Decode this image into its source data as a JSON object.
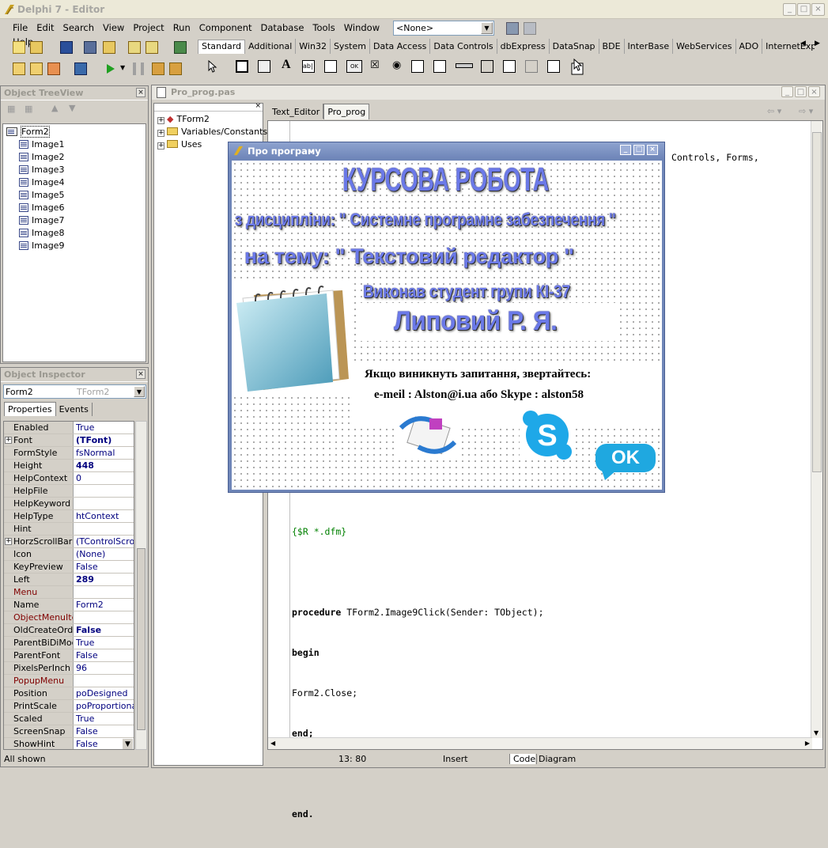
{
  "window": {
    "title": "Delphi 7 - Editor"
  },
  "menu": [
    "File",
    "Edit",
    "Search",
    "View",
    "Project",
    "Run",
    "Component",
    "Database",
    "Tools",
    "Window",
    "Help"
  ],
  "desktop_combo": {
    "value": "<None>"
  },
  "palette_tabs": [
    "Standard",
    "Additional",
    "Win32",
    "System",
    "Data Access",
    "Data Controls",
    "dbExpress",
    "DataSnap",
    "BDE",
    "InterBase",
    "WebServices",
    "ADO",
    "InternetExpre"
  ],
  "object_treeview": {
    "title": "Object TreeView",
    "root": "Form2",
    "items": [
      "Image1",
      "Image2",
      "Image3",
      "Image4",
      "Image5",
      "Image6",
      "Image7",
      "Image8",
      "Image9"
    ]
  },
  "object_inspector": {
    "title": "Object Inspector",
    "selected_object": "Form2",
    "selected_type": "TForm2",
    "tabs": [
      "Properties",
      "Events"
    ],
    "props": [
      {
        "name": "Enabled",
        "value": "True"
      },
      {
        "name": "Font",
        "value": "(TFont)"
      },
      {
        "name": "FormStyle",
        "value": "fsNormal"
      },
      {
        "name": "Height",
        "value": "448"
      },
      {
        "name": "HelpContext",
        "value": "0"
      },
      {
        "name": "HelpFile",
        "value": ""
      },
      {
        "name": "HelpKeyword",
        "value": ""
      },
      {
        "name": "HelpType",
        "value": "htContext"
      },
      {
        "name": "Hint",
        "value": ""
      },
      {
        "name": "HorzScrollBar",
        "value": "(TControlScrollB"
      },
      {
        "name": "Icon",
        "value": "(None)"
      },
      {
        "name": "KeyPreview",
        "value": "False"
      },
      {
        "name": "Left",
        "value": "289"
      },
      {
        "name": "Menu",
        "value": ""
      },
      {
        "name": "Name",
        "value": "Form2"
      },
      {
        "name": "ObjectMenuIter",
        "value": ""
      },
      {
        "name": "OldCreateOrder",
        "value": "False"
      },
      {
        "name": "ParentBiDiMod",
        "value": "True"
      },
      {
        "name": "ParentFont",
        "value": "False"
      },
      {
        "name": "PixelsPerInch",
        "value": "96"
      },
      {
        "name": "PopupMenu",
        "value": ""
      },
      {
        "name": "Position",
        "value": "poDesigned"
      },
      {
        "name": "PrintScale",
        "value": "poProportional"
      },
      {
        "name": "Scaled",
        "value": "True"
      },
      {
        "name": "ScreenSnap",
        "value": "False"
      },
      {
        "name": "ShowHint",
        "value": "False"
      }
    ],
    "footer": "All shown"
  },
  "editor": {
    "title": "Pro_prog.pas",
    "tabs": [
      "Text_Editor",
      "Pro_prog"
    ],
    "explorer": [
      "TForm2",
      "Variables/Constants",
      "Uses"
    ],
    "uses_fragment": "Controls, Forms,",
    "code_lines": [
      "{$R *.dfm}",
      "",
      "procedure TForm2.Image9Click(Sender: TObject);",
      "begin",
      "Form2.Close;",
      "end;",
      "",
      "end."
    ],
    "status": {
      "position": "13:  80",
      "mode": "Insert",
      "tab_code": "Code",
      "tab_diagram": "Diagram"
    }
  },
  "about_form": {
    "title": "Про програму",
    "line1": "КУРСОВА РОБОТА",
    "line2": "з дисципліни: \" Системне програмне забезпечення \"",
    "line3": "на тему: \" Текстовий редактор \"",
    "line4": "Виконав студент групи КІ-37",
    "line5": "Липовий Р. Я.",
    "contact1": "Якщо виникнуть запитання, звертайтесь:",
    "contact2": "e-meil : Alston@i.ua або Skype : alston58",
    "ok_label": "OK"
  }
}
